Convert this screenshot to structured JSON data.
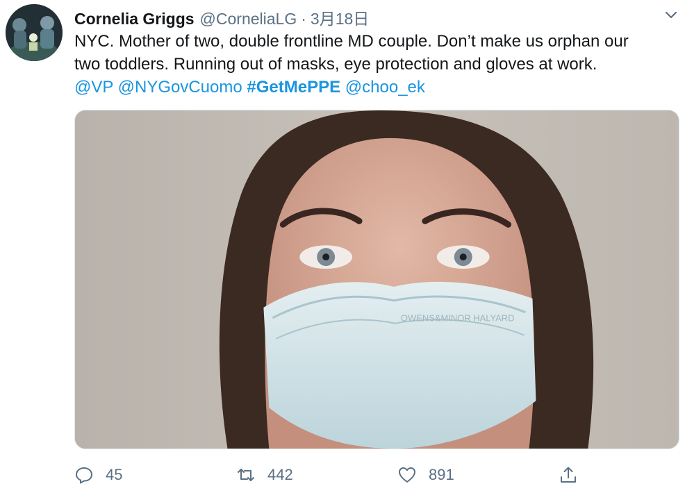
{
  "tweet": {
    "author_name": "Cornelia Griggs",
    "author_handle": "@CorneliaLG",
    "separator": "·",
    "timestamp": "3月18日",
    "text_line1": "NYC. Mother of two, double frontline MD couple. Don’t make us orphan our",
    "text_line2": "two toddlers. Running out of masks, eye protection and gloves at work.",
    "mention1": "@VP",
    "mention2": "@NYGovCuomo",
    "hashtag": "#GetMePPE",
    "mention3": "@choo_ek",
    "mask_brand_text": "OWENS&MINOR HALYARD"
  },
  "actions": {
    "reply_count": "45",
    "retweet_count": "442",
    "like_count": "891"
  },
  "icons": [
    "avatar",
    "chevron-down-icon",
    "reply-icon",
    "retweet-icon",
    "like-icon",
    "share-icon"
  ],
  "colors": {
    "link": "#1b95e0",
    "muted": "#5b7083",
    "text": "#14171a"
  }
}
